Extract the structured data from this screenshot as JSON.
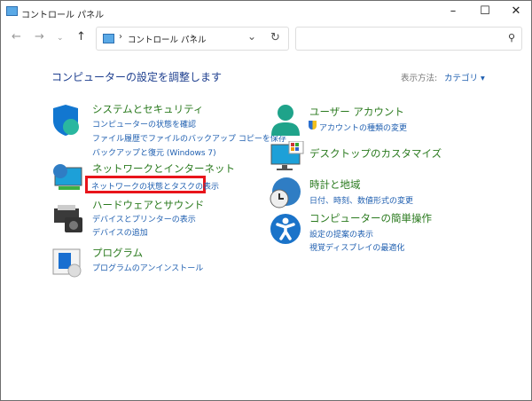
{
  "window": {
    "title": "コントロール パネル"
  },
  "address": {
    "crumb": "コントロール パネル",
    "sep": "›"
  },
  "search": {
    "placeholder": ""
  },
  "heading": "コンピューターの設定を調整します",
  "view": {
    "label": "表示方法:",
    "value": "カテゴリ ▾"
  },
  "categories": [
    {
      "title": "システムとセキュリティ",
      "links": [
        "コンピューターの状態を確認",
        "ファイル履歴でファイルのバックアップ コピーを保存",
        "バックアップと復元 (Windows 7)"
      ]
    },
    {
      "title": "ネットワークとインターネット",
      "links": [
        "ネットワークの状態とタスクの表示"
      ]
    },
    {
      "title": "ハードウェアとサウンド",
      "links": [
        "デバイスとプリンターの表示",
        "デバイスの追加"
      ]
    },
    {
      "title": "プログラム",
      "links": [
        "プログラムのアンインストール"
      ]
    },
    {
      "title": "ユーザー アカウント",
      "links": [
        "アカウントの種類の変更"
      ]
    },
    {
      "title": "デスクトップのカスタマイズ",
      "links": []
    },
    {
      "title": "時計と地域",
      "links": [
        "日付、時刻、数値形式の変更"
      ]
    },
    {
      "title": "コンピューターの簡単操作",
      "links": [
        "設定の提案の表示",
        "視覚ディスプレイの最適化"
      ]
    }
  ],
  "highlight_color": "#e8141b"
}
